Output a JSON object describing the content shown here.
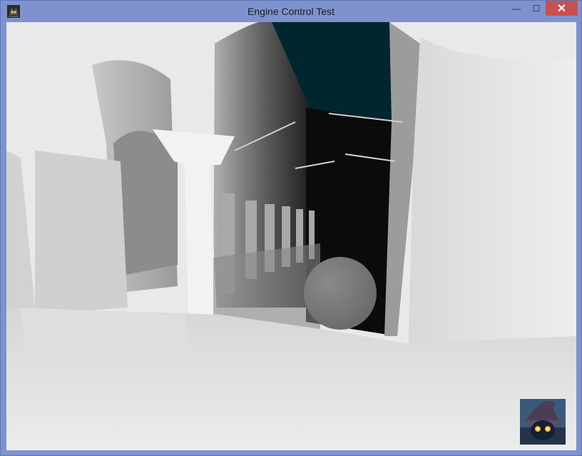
{
  "window": {
    "title": "Engine Control Test",
    "minimize_glyph": "—",
    "maximize_glyph": "☐",
    "close_glyph": "✕"
  },
  "icons": {
    "app_icon": "game-character-icon",
    "thumbnail": "wizard-character-icon"
  },
  "colors": {
    "frame": "#7d92cf",
    "close_button": "#c75050",
    "sky": "#02262e"
  }
}
